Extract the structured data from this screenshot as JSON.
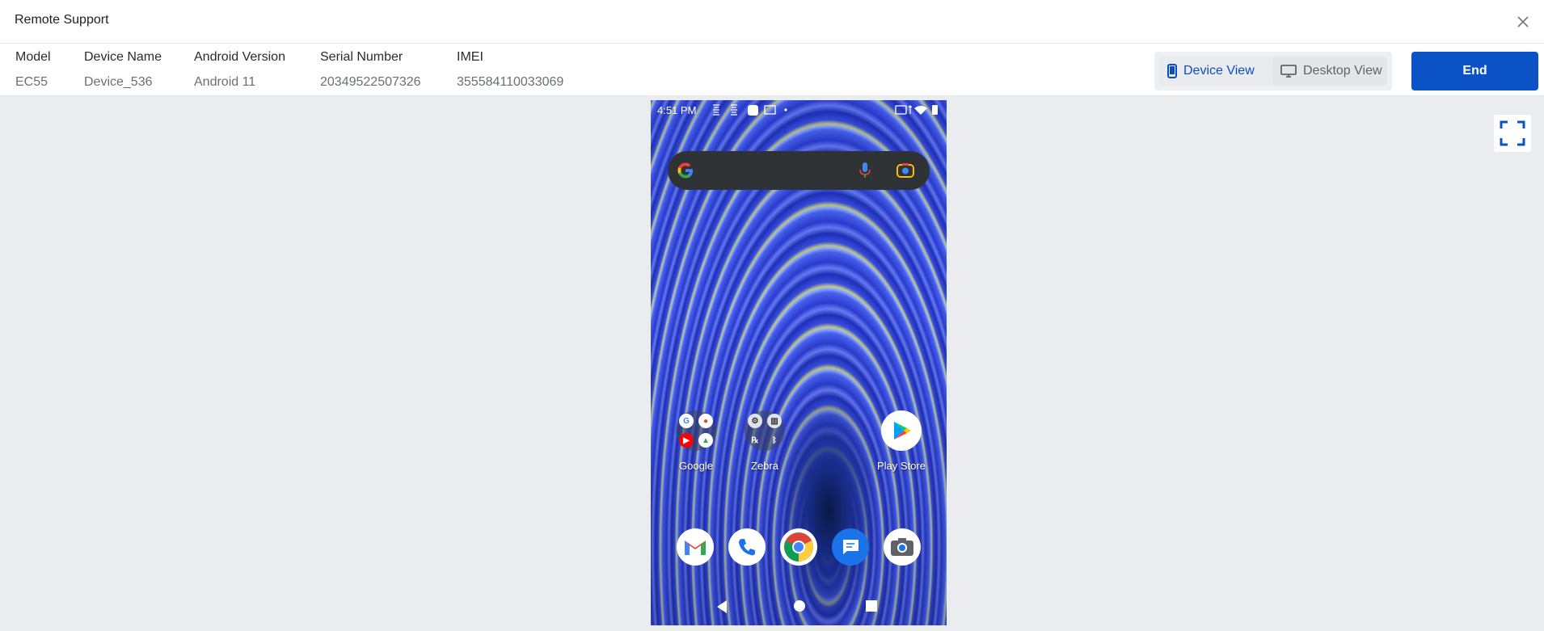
{
  "header": {
    "title": "Remote Support"
  },
  "device_info": {
    "columns": [
      {
        "label": "Model",
        "value": "EC55"
      },
      {
        "label": "Device Name",
        "value": "Device_536"
      },
      {
        "label": "Android Version",
        "value": "Android 11"
      },
      {
        "label": "Serial Number",
        "value": "20349522507326"
      },
      {
        "label": "IMEI",
        "value": "355584110033069"
      }
    ]
  },
  "view_toggle": {
    "device_view_label": "Device View",
    "desktop_view_label": "Desktop View",
    "selected": "Device View"
  },
  "actions": {
    "end_label": "End"
  },
  "phone": {
    "status_time": "4:51 PM",
    "home_apps": [
      {
        "label": "Google"
      },
      {
        "label": "Zebra"
      },
      {
        "label": "Play Store"
      }
    ],
    "dock_apps": [
      "gmail-icon",
      "phone-icon",
      "chrome-icon",
      "messages-icon",
      "camera-icon"
    ]
  },
  "colors": {
    "accent": "#0b52c7",
    "background": "#ebecf0"
  }
}
